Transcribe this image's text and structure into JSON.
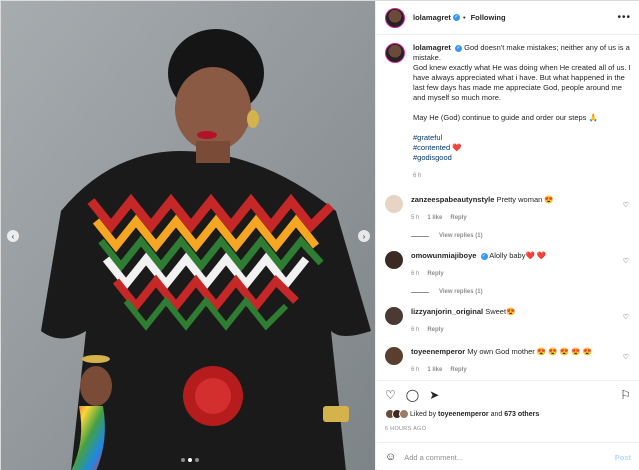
{
  "post": {
    "username": "lolamagret",
    "follow_state": "Following",
    "more_icon": "more-horizontal-icon"
  },
  "caption": {
    "username": "lolamagret",
    "lines": [
      "God doesn't make mistakes; neither any of us is a mistake.",
      "God knew exactly what He was doing when He created all of us. I have always appreciated what i have. But what happened in the last few days has made me appreciate God, people around me and myself so much more.",
      "May He (God) continue to guide and order our steps 🙏"
    ],
    "hashtags": [
      "#grateful",
      "#contented ❤️",
      "#godisgood"
    ],
    "age": "6 h"
  },
  "comments": [
    {
      "username": "zanzeespabeautynstyle",
      "text": "Pretty woman 😍",
      "age": "5 h",
      "likes": "1 like",
      "reply": "Reply",
      "view_replies": "View replies (1)"
    },
    {
      "username": "omowunmiajiboye",
      "text": "Alolly baby❤️ ❤️",
      "age": "6 h",
      "likes": "",
      "reply": "Reply",
      "view_replies": "View replies (1)"
    },
    {
      "username": "lizzyanjorin_original",
      "text": "Sweet😍",
      "age": "6 h",
      "likes": "",
      "reply": "Reply",
      "view_replies": ""
    },
    {
      "username": "toyeenemperor",
      "text": "My own God mother 😍 😍 😍 😍 😍",
      "age": "6 h",
      "likes": "1 like",
      "reply": "Reply",
      "view_replies": ""
    }
  ],
  "actions": {
    "liked_by_prefix": "Liked by",
    "liked_by_user": "toyeenemperor",
    "liked_by_and": "and",
    "others": "673 others",
    "timestamp": "6 HOURS AGO"
  },
  "add_comment": {
    "placeholder": "Add a comment...",
    "post_label": "Post"
  },
  "colors": {
    "accent": "#3897f0",
    "verified": "#3897f0",
    "post_disabled": "#b3dbff",
    "secondary_text": "#8e8e8e"
  }
}
